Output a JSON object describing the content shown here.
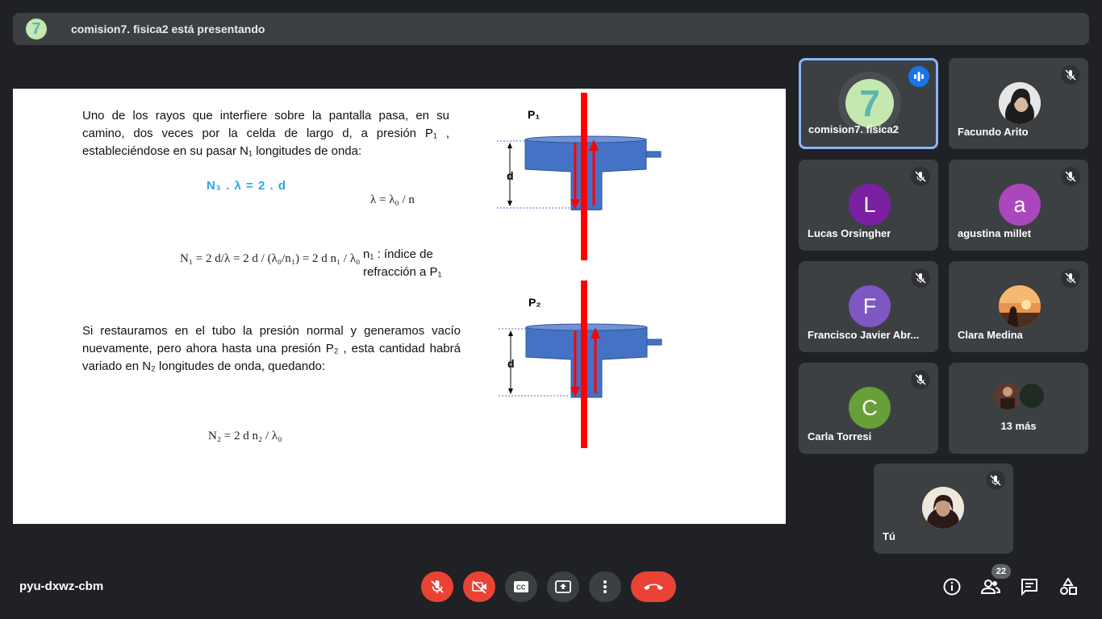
{
  "banner": {
    "avatar_initial": "7",
    "text": "comision7. fisica2 está presentando"
  },
  "slide": {
    "para1": "Uno de los rayos que interfiere sobre la pantalla pasa, en su camino, dos veces por la celda de largo d, a presión P₁ , estableciéndose en su pasar N₁ longitudes de onda:",
    "eq_blue": "N₁ . λ = 2 . d",
    "eq_lambda": "λ = λ₀ / n",
    "eq_n1": "N₁ = 2 d/λ = 2 d / (λ₀/n₁) = 2 d n₁ / λ₀",
    "n1_label_1": "n₁ : índice de",
    "n1_label_2": "refracción a P₁",
    "para2": "Si restauramos en el tubo la presión normal y generamos vacío nuevamente, pero ahora hasta una presión P₂ , esta cantidad habrá variado en N₂ longitudes de onda, quedando:",
    "eq_n2": "N₂ = 2 d n₂ / λ₀",
    "diagram_top": {
      "pressure": "P₁",
      "length": "d"
    },
    "diagram_bottom": {
      "pressure": "P₂",
      "length": "d"
    }
  },
  "participants": [
    {
      "name": "comision7. fisica2",
      "type": "logo",
      "state": "speaking"
    },
    {
      "name": "Facundo Arito",
      "type": "photo",
      "state": "muted"
    },
    {
      "name": "Lucas Orsingher",
      "initial": "L",
      "color": "#7b1fa2",
      "state": "muted"
    },
    {
      "name": "agustina millet",
      "initial": "a",
      "color": "#ab47bc",
      "state": "muted"
    },
    {
      "name": "Francisco Javier Abr...",
      "initial": "F",
      "color": "#7e57c2",
      "state": "muted"
    },
    {
      "name": "Clara Medina",
      "type": "photo",
      "state": "muted"
    },
    {
      "name": "Carla Torresi",
      "initial": "C",
      "color": "#689f38",
      "state": "muted"
    },
    {
      "name": "13 más",
      "type": "overflow"
    },
    {
      "name": "Tú",
      "type": "photo",
      "state": "muted"
    }
  ],
  "footer": {
    "meeting_code": "pyu-dxwz-cbm",
    "participant_count": "22",
    "controls": [
      "mic-off",
      "camera-off",
      "captions",
      "present",
      "more-options",
      "leave-call"
    ],
    "right_icons": [
      "info",
      "people",
      "chat",
      "activities"
    ]
  },
  "colors": {
    "accent": "#8ab4f8",
    "danger": "#ea4335",
    "surface": "#3c4043",
    "background": "#202124"
  }
}
